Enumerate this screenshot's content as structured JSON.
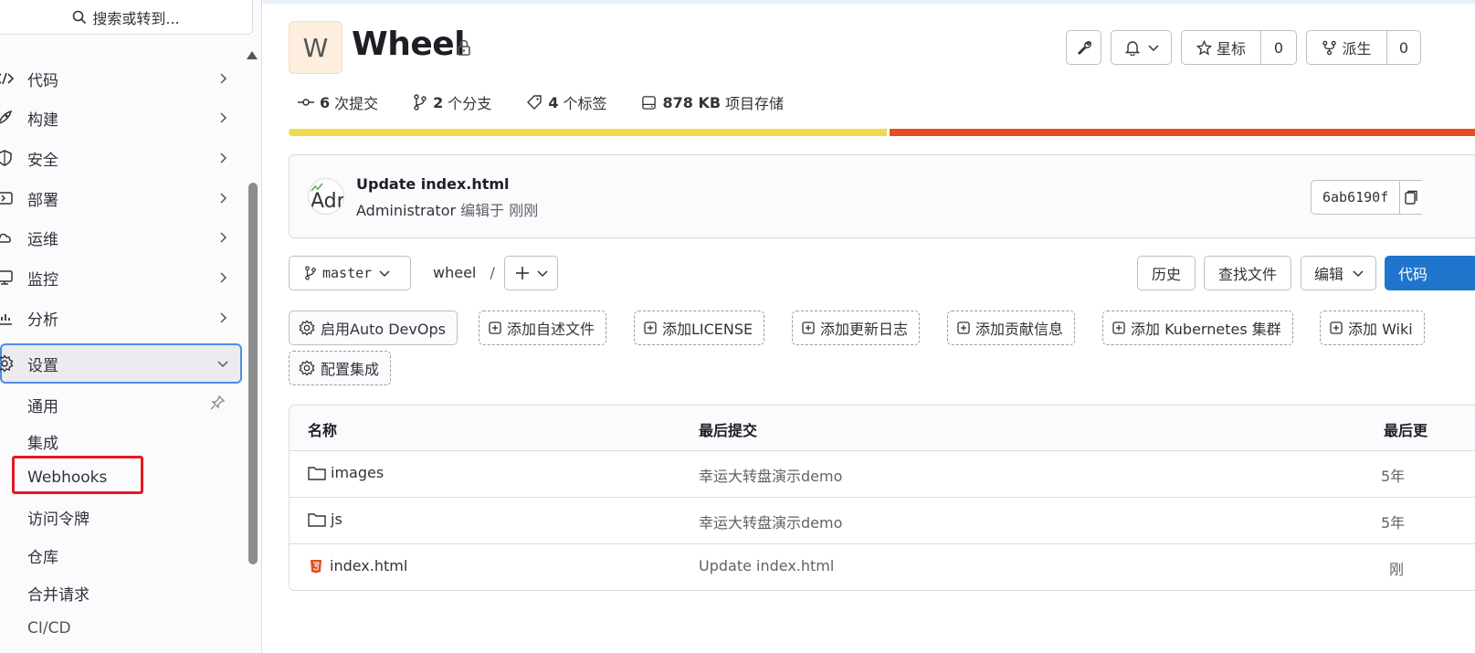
{
  "sidebar": {
    "search_placeholder": "搜索或转到...",
    "items": [
      {
        "label": "代码",
        "icon": "code-icon"
      },
      {
        "label": "构建",
        "icon": "rocket-icon"
      },
      {
        "label": "安全",
        "icon": "shield-icon"
      },
      {
        "label": "部署",
        "icon": "deploy-icon"
      },
      {
        "label": "运维",
        "icon": "cloud-icon"
      },
      {
        "label": "监控",
        "icon": "monitor-icon"
      },
      {
        "label": "分析",
        "icon": "chart-icon"
      },
      {
        "label": "设置",
        "icon": "settings-icon",
        "expanded": true
      }
    ],
    "settings_sub": [
      "通用",
      "集成",
      "Webhooks",
      "访问令牌",
      "仓库",
      "合并请求",
      "CI/CD"
    ]
  },
  "project": {
    "avatar_letter": "W",
    "name": "Wheel",
    "star_label": "星标",
    "star_count": "0",
    "fork_label": "派生",
    "fork_count": "0"
  },
  "stats": {
    "commits_num": "6",
    "commits_label": "次提交",
    "branches_num": "2",
    "branches_label": "个分支",
    "tags_num": "4",
    "tags_label": "个标签",
    "storage_num": "878 KB",
    "storage_label": "项目存储"
  },
  "languages": {
    "colors": [
      "#f0da4e",
      "#e44d26"
    ]
  },
  "last_commit": {
    "title": "Update index.html",
    "author": "Administrator",
    "meta": "编辑于 刚刚",
    "sha": "6ab6190f",
    "avatar_alt": "Adr"
  },
  "repo_nav": {
    "branch": "master",
    "path_root": "wheel",
    "path_sep": "/",
    "history": "历史",
    "find_file": "查找文件",
    "edit": "编辑",
    "code": "代码"
  },
  "quick_actions": [
    "启用Auto DevOps",
    "添加自述文件",
    "添加LICENSE",
    "添加更新日志",
    "添加贡献信息",
    "添加 Kubernetes 集群",
    "添加 Wiki",
    "配置集成"
  ],
  "files_table": {
    "headers": [
      "名称",
      "最后提交",
      "最后更"
    ],
    "rows": [
      {
        "name": "images",
        "type": "folder",
        "commit": "幸运大转盘演示demo",
        "date": "5年"
      },
      {
        "name": "js",
        "type": "folder",
        "commit": "幸运大转盘演示demo",
        "date": "5年"
      },
      {
        "name": "index.html",
        "type": "html",
        "commit": "Update index.html",
        "date": "刚"
      }
    ]
  }
}
